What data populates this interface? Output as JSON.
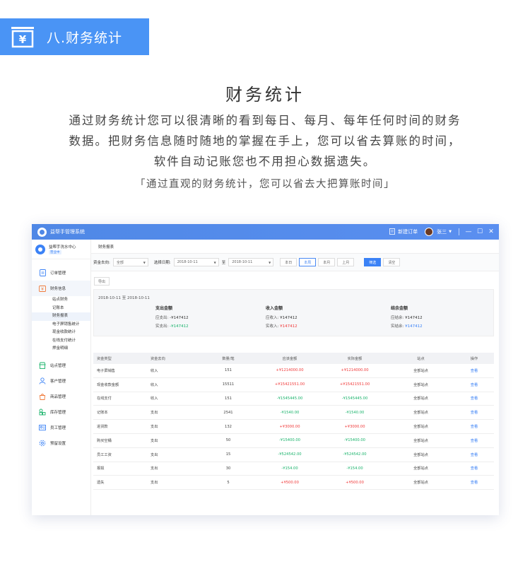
{
  "header": {
    "badge_text": "八.财务统计",
    "title": "财务统计",
    "description": "通过财务统计您可以很清晰的看到每日、每月、每年任何时间的财务数据。把财务信息随时随地的掌握在手上，您可以省去算账的时间，软件自动记账您也不用担心数据遗失。",
    "quote": "「通过直观的财务统计，您可以省去大把算账时间」"
  },
  "app": {
    "name": "益帮手管理系统",
    "new_order": "新建订单",
    "user_name": "张三",
    "store_name": "益帮手洗水中心",
    "store_badge": "营业中"
  },
  "sidebar": {
    "items": [
      {
        "label": "订单管理"
      },
      {
        "label": "财务信息"
      },
      {
        "label": "站点管理"
      },
      {
        "label": "客户管理"
      },
      {
        "label": "商品管理"
      },
      {
        "label": "库存管理"
      },
      {
        "label": "员工管理"
      },
      {
        "label": "预留设置"
      }
    ],
    "sub_items": [
      "站点财务",
      "记账本",
      "财务报表",
      "电子屏销售统计",
      "现金收款统计",
      "在线支付统计",
      "押金明细"
    ]
  },
  "page": {
    "tab": "财务报表",
    "flow_label": "资金去向:",
    "flow_value": "全部",
    "date_label": "选择日期:",
    "date_from": "2018-10-11",
    "to_label": "至",
    "date_to": "2018-10-11",
    "btn_today": "本日",
    "btn_week": "本周",
    "btn_month": "本月",
    "btn_last": "上月",
    "btn_filter": "筛选",
    "btn_clear": "清空",
    "btn_export": "导出"
  },
  "summary": {
    "range": "2018-10-11 至 2018-10-11",
    "expense": {
      "title": "支出金额",
      "l1": "应支出:",
      "v1": "-¥147412",
      "l2": "实支出:",
      "v2": "-¥147412"
    },
    "income": {
      "title": "收入金额",
      "l1": "应收入:",
      "v1": "¥147412",
      "l2": "实收入:",
      "v2": "¥147412"
    },
    "balance": {
      "title": "结余金额",
      "l1": "应结余:",
      "v1": "¥147412",
      "l2": "实结余:",
      "v2": "¥147412"
    }
  },
  "table": {
    "headers": [
      "资金类型",
      "资金去向",
      "数量/笔",
      "应该金额",
      "实际金额",
      "站点",
      "操作"
    ],
    "rows": [
      [
        "电子屏销售",
        "收入",
        "151",
        "+¥1214000.00",
        "+¥1214000.00",
        "全部站点",
        "查看"
      ],
      [
        "现金收款金额",
        "收入",
        "15511",
        "+¥15421551.00",
        "+¥15421551.00",
        "全部站点",
        "查看"
      ],
      [
        "在线支付",
        "收入",
        "151",
        "-¥1545445.00",
        "-¥1545445.00",
        "全部站点",
        "查看"
      ],
      [
        "记账本",
        "支出",
        "2541",
        "-¥1540.00",
        "-¥1540.00",
        "全部站点",
        "查看"
      ],
      [
        "进货款",
        "支出",
        "132",
        "+¥3000.00",
        "+¥3000.00",
        "全部站点",
        "查看"
      ],
      [
        "购买空桶",
        "支出",
        "50",
        "-¥15400.00",
        "-¥15400.00",
        "全部站点",
        "查看"
      ],
      [
        "员工工资",
        "支出",
        "15",
        "-¥524542.00",
        "-¥524542.00",
        "全部站点",
        "查看"
      ],
      [
        "报损",
        "支出",
        "30",
        "-¥154.00",
        "-¥154.00",
        "全部站点",
        "查看"
      ],
      [
        "遗失",
        "支出",
        "5",
        "+¥500.00",
        "+¥500.00",
        "全部站点",
        "查看"
      ]
    ]
  },
  "colors": {
    "accent": "#3b82f6",
    "positive": "#f03a3a",
    "negative": "#19b36b"
  }
}
